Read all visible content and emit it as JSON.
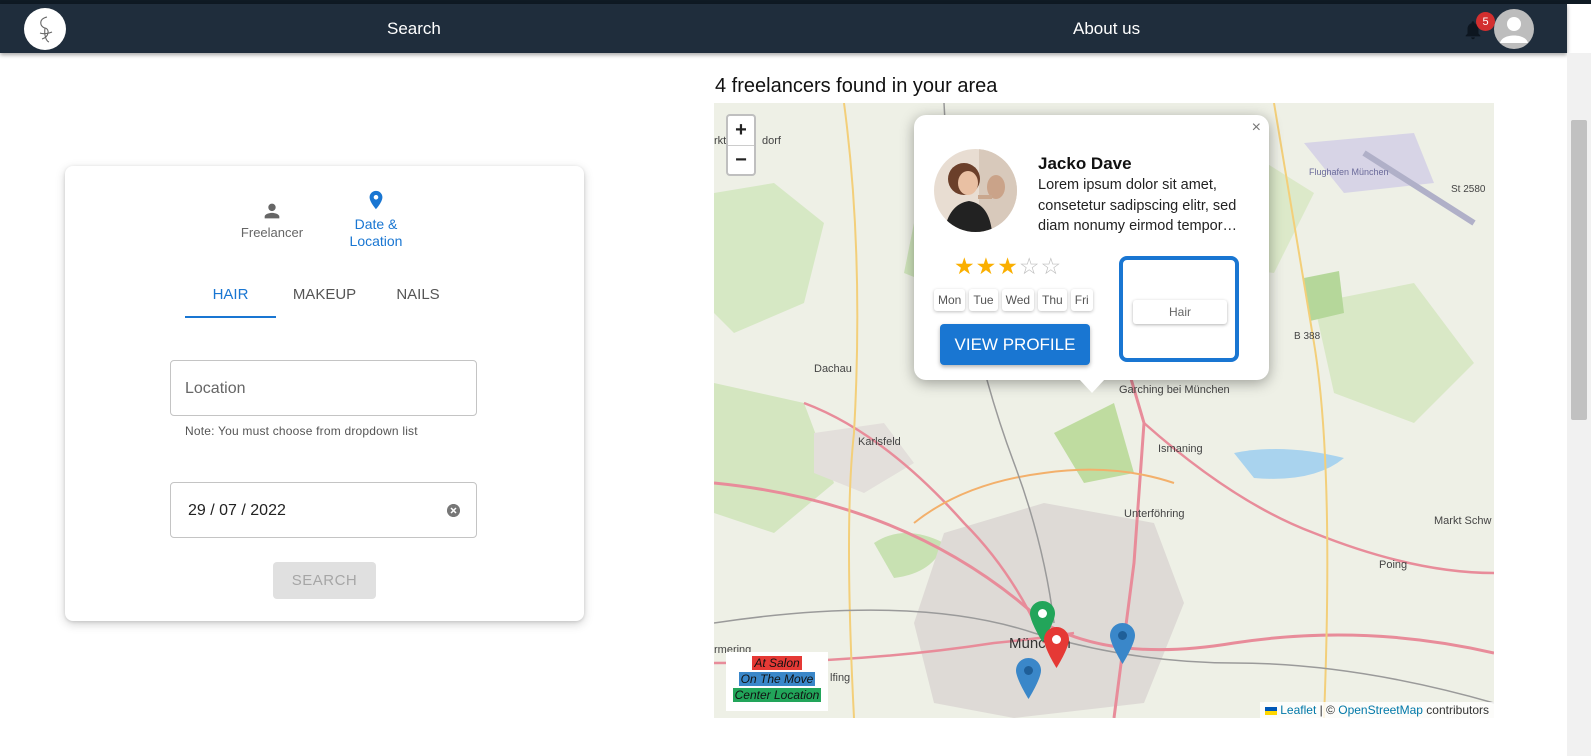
{
  "navbar": {
    "search_label": "Search",
    "about_label": "About us",
    "notification_count": "5"
  },
  "search_card": {
    "steps": [
      {
        "label": "Freelancer",
        "icon": "person-icon"
      },
      {
        "label": "Date & Location",
        "icon": "location-pin-icon"
      }
    ],
    "tabs": [
      "HAIR",
      "MAKEUP",
      "NAILS"
    ],
    "active_tab": "HAIR",
    "location_placeholder": "Location",
    "location_note": "Note: You must choose from dropdown list",
    "date_value": "29 / 07 / 2022",
    "search_button": "SEARCH"
  },
  "results": {
    "title": "4 freelancers found in your area"
  },
  "map": {
    "zoom_in": "+",
    "zoom_out": "−",
    "places": [
      "Dachau",
      "Karlsfeld",
      "Ismaning",
      "Unterföhring",
      "München",
      "Poing",
      "Markt Schw",
      "Garching bei München",
      "Flughafen München",
      "St 2580",
      "B 388",
      "rkt",
      "dorf",
      "rmering",
      "lfing"
    ],
    "legend": [
      {
        "label": "At Salon",
        "color": "#e53935"
      },
      {
        "label": "On The Move",
        "color": "#3a87c9"
      },
      {
        "label": "Center Location",
        "color": "#22a55a"
      }
    ],
    "attribution": {
      "leaflet": "Leaflet",
      "sep": " | © ",
      "osm": "OpenStreetMap",
      "contributors": " contributors"
    },
    "markers": [
      {
        "type": "Center Location",
        "color": "#22a55a"
      },
      {
        "type": "At Salon",
        "color": "#e53935"
      },
      {
        "type": "On The Move",
        "color": "#3a87c9"
      },
      {
        "type": "On The Move",
        "color": "#3a87c9"
      }
    ]
  },
  "popup": {
    "close": "×",
    "name": "Jacko Dave",
    "description": "Lorem ipsum dolor sit amet, consetetur sadipscing elitr, sed diam nonumy eirmod tempor…",
    "rating": 3,
    "rating_max": 5,
    "days": [
      "Mon",
      "Tue",
      "Wed",
      "Thu",
      "Fri"
    ],
    "view_profile": "VIEW PROFILE",
    "category": "Hair"
  },
  "colors": {
    "navbar": "#1f2d3c",
    "primary": "#1976d2",
    "star": "#faaf00"
  }
}
